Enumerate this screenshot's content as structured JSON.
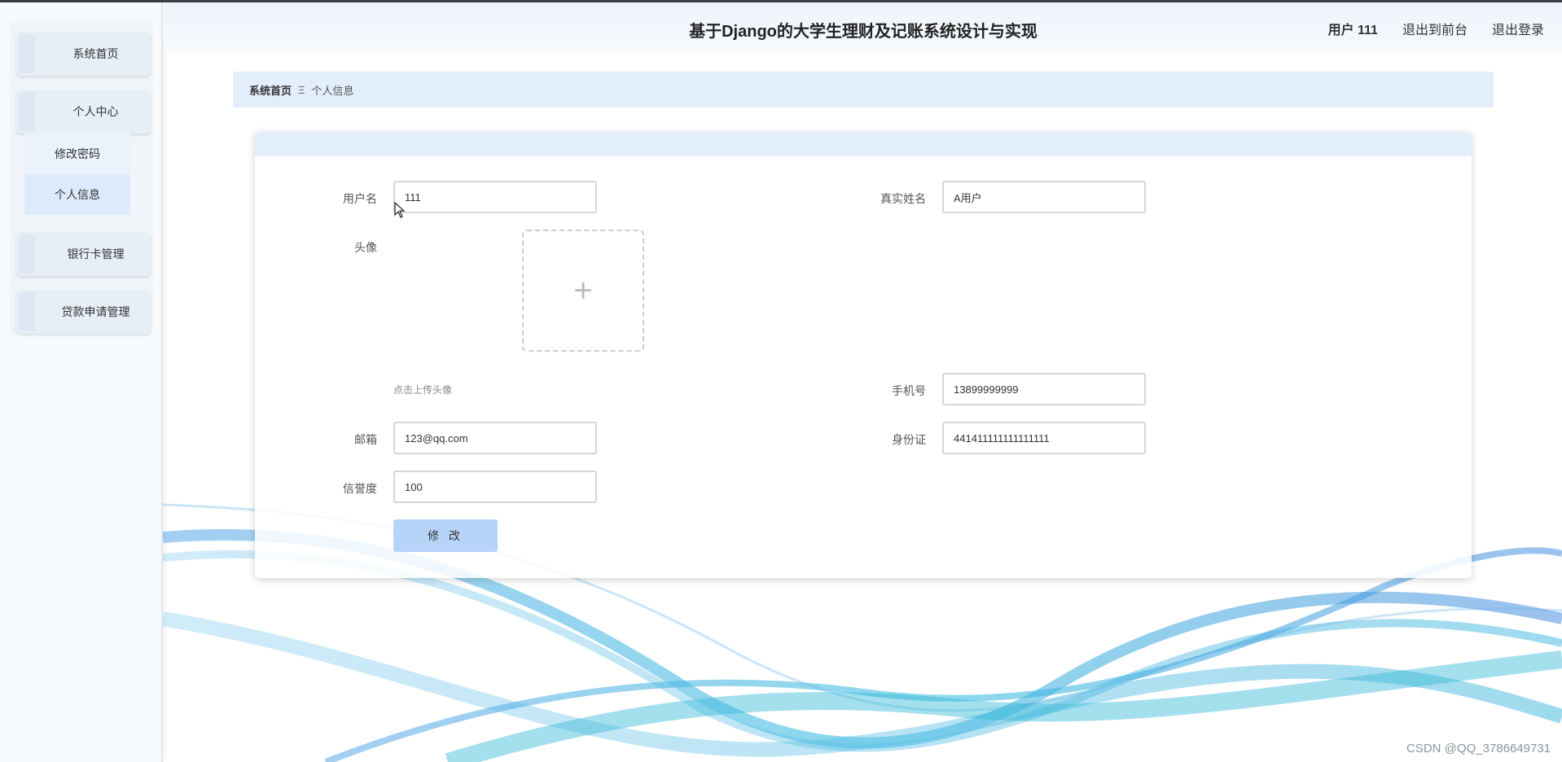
{
  "header": {
    "title": "基于Django的大学生理财及记账系统设计与实现",
    "user_label": "用户 111",
    "back_to_front": "退出到前台",
    "logout": "退出登录"
  },
  "sidebar": {
    "items": [
      {
        "label": "系统首页"
      },
      {
        "label": "个人中心",
        "children": [
          {
            "label": "修改密码"
          },
          {
            "label": "个人信息"
          }
        ]
      },
      {
        "label": "银行卡管理"
      },
      {
        "label": "贷款申请管理"
      }
    ]
  },
  "breadcrumb": {
    "home": "系统首页",
    "separator": "Ξ",
    "current": "个人信息"
  },
  "form": {
    "username_label": "用户名",
    "username_value": "111",
    "realname_label": "真实姓名",
    "realname_value": "A用户",
    "avatar_label": "头像",
    "avatar_plus": "+",
    "upload_hint": "点击上传头像",
    "phone_label": "手机号",
    "phone_value": "13899999999",
    "email_label": "邮箱",
    "email_value": "123@qq.com",
    "idcard_label": "身份证",
    "idcard_value": "441411111111111111",
    "credit_label": "信誉度",
    "credit_value": "100",
    "submit_label": "修 改"
  },
  "watermark": "CSDN @QQ_3786649731",
  "colors": {
    "accent": "#b6d4f8",
    "breadcrumb_bg": "#e2eefb",
    "card_header_bg": "#e3effb"
  }
}
